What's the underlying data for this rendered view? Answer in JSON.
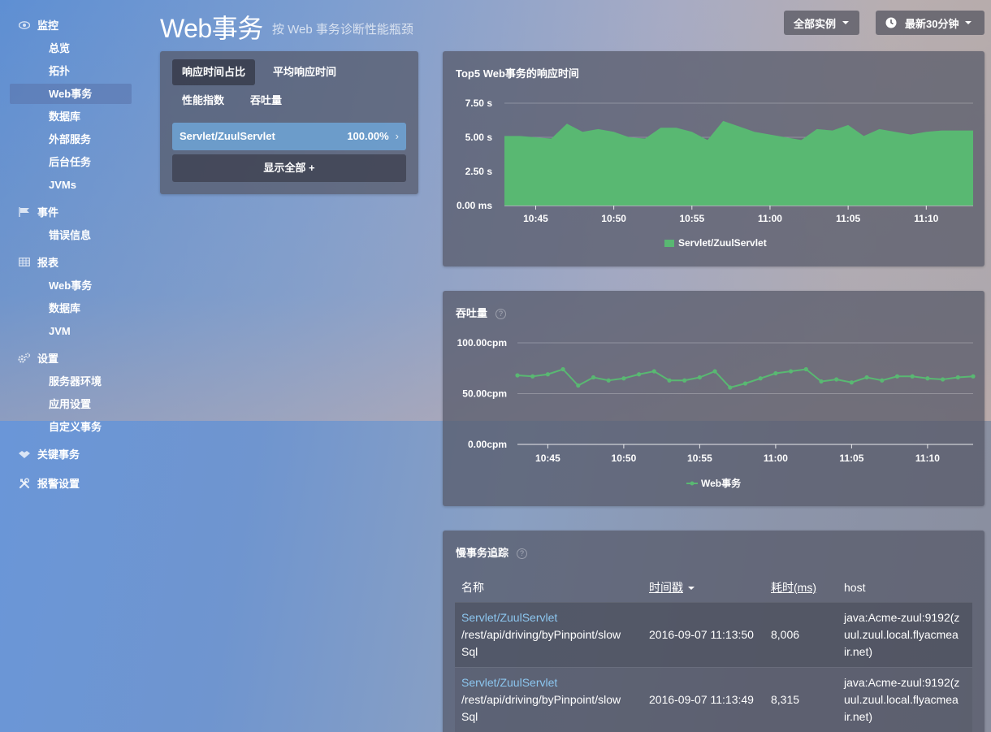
{
  "sidebar": {
    "groups": [
      {
        "label": "监控",
        "icon": "eye-icon"
      },
      {
        "label": "事件",
        "icon": "flag-icon"
      },
      {
        "label": "报表",
        "icon": "table-icon"
      },
      {
        "label": "设置",
        "icon": "gear-icon"
      },
      {
        "label": "关键事务",
        "icon": "handshake-icon"
      },
      {
        "label": "报警设置",
        "icon": "wrench-icon"
      }
    ],
    "items": [
      {
        "label": "总览"
      },
      {
        "label": "拓扑"
      },
      {
        "label": "Web事务",
        "active": true
      },
      {
        "label": "数据库"
      },
      {
        "label": "外部服务"
      },
      {
        "label": "后台任务"
      },
      {
        "label": "JVMs"
      },
      {
        "label": "错误信息"
      },
      {
        "label": "Web事务"
      },
      {
        "label": "数据库"
      },
      {
        "label": "JVM"
      },
      {
        "label": "服务器环境"
      },
      {
        "label": "应用设置"
      },
      {
        "label": "自定义事务"
      }
    ]
  },
  "header": {
    "title": "Web事务",
    "subtitle": "按 Web 事务诊断性能瓶颈",
    "instances_label": "全部实例",
    "time_label": "最新30分钟"
  },
  "left_panel": {
    "tabs": [
      "响应时间占比",
      "平均响应时间",
      "性能指数",
      "吞吐量"
    ],
    "row": {
      "name": "Servlet/ZuulServlet",
      "value": "100.00%"
    },
    "show_all": "显示全部 +"
  },
  "response_chart": {
    "title": "Top5 Web事务的响应时间",
    "legend": "Servlet/ZuulServlet"
  },
  "throughput_chart": {
    "title": "吞吐量",
    "legend": "Web事务"
  },
  "slow_panel": {
    "title": "慢事务追踪",
    "columns": [
      "名称",
      "时间戳",
      "耗时(ms)",
      "host"
    ],
    "rows": [
      {
        "name": "Servlet/ZuulServlet",
        "path1": "/rest/api/driving/byPinpoint/slow",
        "path2": "Sql",
        "time": "2016-09-07 11:13:50",
        "duration": "8,006",
        "host1": "java:Acme-zuul:9192(z",
        "host2": "uul.zuul.local.flyacmea",
        "host3": "ir.net)"
      },
      {
        "name": "Servlet/ZuulServlet",
        "path1": "/rest/api/driving/byPinpoint/slow",
        "path2": "Sql",
        "time": "2016-09-07 11:13:49",
        "duration": "8,315",
        "host1": "java:Acme-zuul:9192(z",
        "host2": "uul.zuul.local.flyacmea",
        "host3": "ir.net)"
      }
    ]
  },
  "chart_data": [
    {
      "type": "area",
      "title": "Top5 Web事务的响应时间",
      "ylabel": "",
      "yticks": [
        "0.00 ms",
        "2.50 s",
        "5.00 s",
        "7.50 s"
      ],
      "ylim": [
        0,
        7.5
      ],
      "xticks": [
        "10:45",
        "10:50",
        "10:55",
        "11:00",
        "11:05",
        "11:10"
      ],
      "x": [
        "10:43",
        "10:44",
        "10:45",
        "10:46",
        "10:47",
        "10:48",
        "10:49",
        "10:50",
        "10:51",
        "10:52",
        "10:53",
        "10:54",
        "10:55",
        "10:56",
        "10:57",
        "10:58",
        "10:59",
        "11:00",
        "11:01",
        "11:02",
        "11:03",
        "11:04",
        "11:05",
        "11:06",
        "11:07",
        "11:08",
        "11:09",
        "11:10",
        "11:11",
        "11:12",
        "11:13"
      ],
      "series": [
        {
          "name": "Servlet/ZuulServlet",
          "color": "#59b872",
          "values": [
            5.1,
            5.1,
            5.0,
            4.9,
            6.0,
            5.4,
            5.6,
            5.4,
            5.0,
            4.9,
            5.7,
            5.7,
            5.4,
            4.8,
            6.2,
            5.8,
            5.4,
            5.2,
            5.0,
            4.8,
            5.6,
            5.5,
            5.9,
            5.1,
            5.6,
            5.4,
            5.2,
            5.4,
            5.5,
            5.5,
            5.5
          ]
        }
      ],
      "legend": "bottom"
    },
    {
      "type": "line",
      "title": "吞吐量",
      "yticks": [
        "0.00cpm",
        "50.00cpm",
        "100.00cpm"
      ],
      "ylim": [
        0,
        100
      ],
      "xticks": [
        "10:45",
        "10:50",
        "10:55",
        "11:00",
        "11:05",
        "11:10"
      ],
      "x": [
        "10:43",
        "10:44",
        "10:45",
        "10:46",
        "10:47",
        "10:48",
        "10:49",
        "10:50",
        "10:51",
        "10:52",
        "10:53",
        "10:54",
        "10:55",
        "10:56",
        "10:57",
        "10:58",
        "10:59",
        "11:00",
        "11:01",
        "11:02",
        "11:03",
        "11:04",
        "11:05",
        "11:06",
        "11:07",
        "11:08",
        "11:09",
        "11:10",
        "11:11",
        "11:12",
        "11:13"
      ],
      "series": [
        {
          "name": "Web事务",
          "color": "#59b872",
          "values": [
            68,
            67,
            69,
            74,
            58,
            66,
            63,
            65,
            69,
            72,
            63,
            63,
            66,
            72,
            56,
            60,
            65,
            70,
            72,
            74,
            62,
            64,
            61,
            66,
            63,
            67,
            67,
            65,
            64,
            66,
            67
          ]
        }
      ],
      "legend": "bottom"
    }
  ]
}
